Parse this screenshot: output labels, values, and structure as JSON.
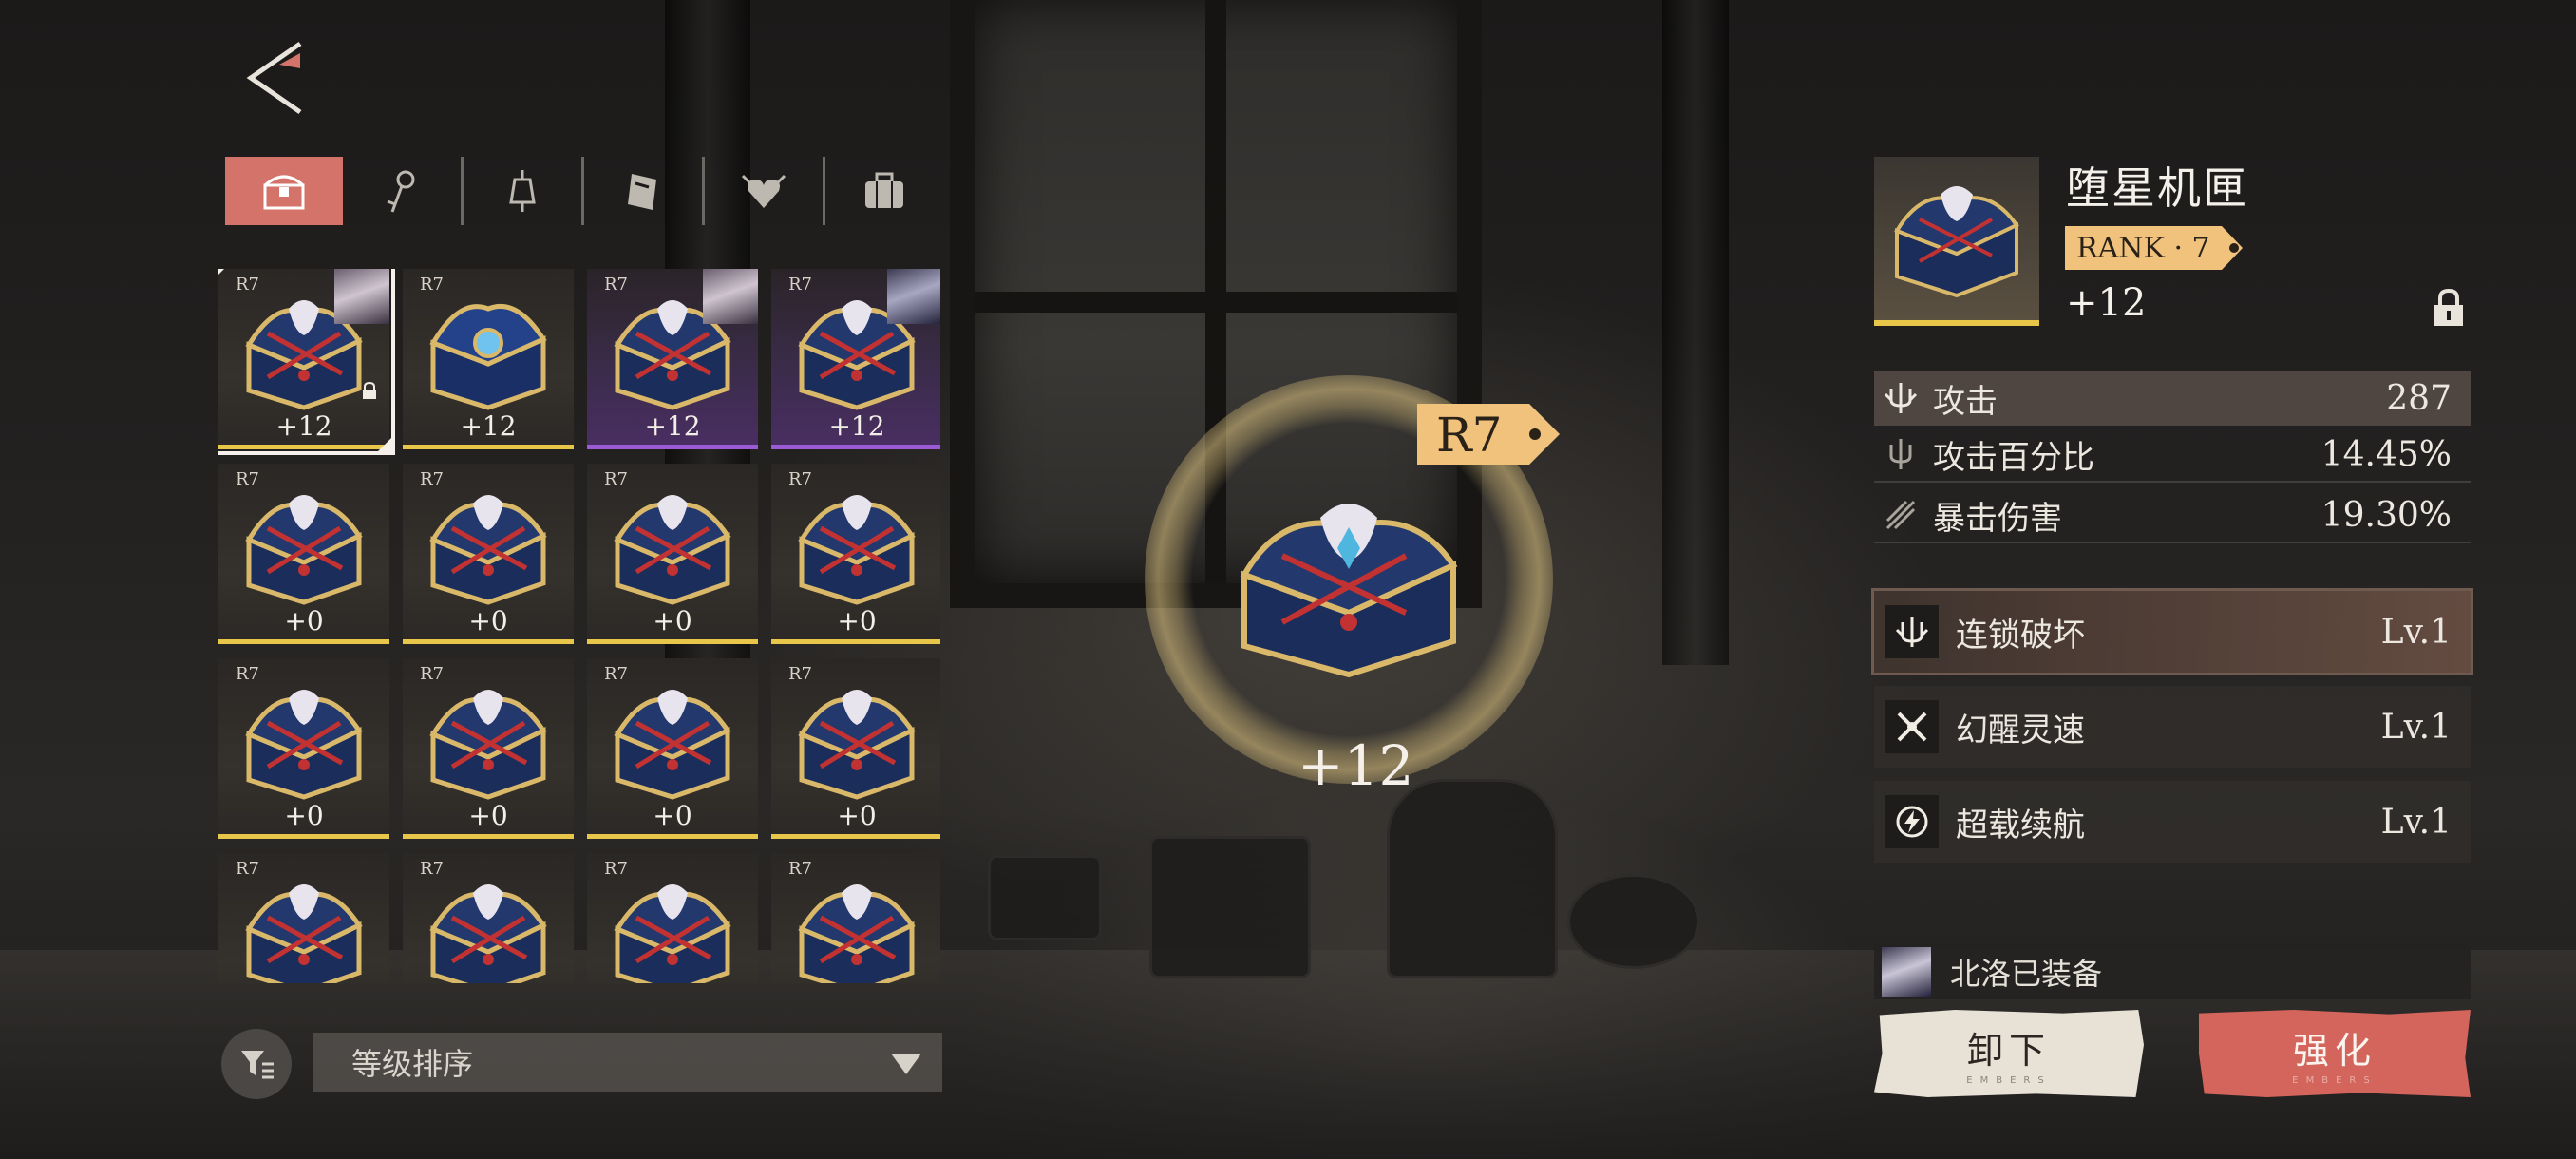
{
  "tabs": [
    {
      "name": "chest-tab",
      "icon": "chest-icon",
      "active": true
    },
    {
      "name": "key-tab",
      "icon": "key-icon",
      "active": false
    },
    {
      "name": "lantern-tab",
      "icon": "lantern-icon",
      "active": false
    },
    {
      "name": "book-tab",
      "icon": "book-icon",
      "active": false
    },
    {
      "name": "heart-tab",
      "icon": "winged-heart-icon",
      "active": false
    },
    {
      "name": "suitcase-tab",
      "icon": "suitcase-icon",
      "active": false
    }
  ],
  "grid": {
    "items": [
      {
        "rank": "R7",
        "level": "+12",
        "rarity": "gold",
        "equipped_avatar": true,
        "locked": true,
        "selected": true,
        "chest": "starfall"
      },
      {
        "rank": "R7",
        "level": "+12",
        "rarity": "gold",
        "equipped_avatar": false,
        "locked": false,
        "selected": false,
        "chest": "blue-gem"
      },
      {
        "rank": "R7",
        "level": "+12",
        "rarity": "purple",
        "equipped_avatar": true,
        "locked": false,
        "selected": false,
        "chest": "starfall"
      },
      {
        "rank": "R7",
        "level": "+12",
        "rarity": "purple",
        "equipped_avatar": true,
        "locked": false,
        "selected": false,
        "chest": "starfall"
      },
      {
        "rank": "R7",
        "level": "+0",
        "rarity": "gold",
        "chest": "starfall"
      },
      {
        "rank": "R7",
        "level": "+0",
        "rarity": "gold",
        "chest": "starfall"
      },
      {
        "rank": "R7",
        "level": "+0",
        "rarity": "gold",
        "chest": "starfall"
      },
      {
        "rank": "R7",
        "level": "+0",
        "rarity": "gold",
        "chest": "starfall"
      },
      {
        "rank": "R7",
        "level": "+0",
        "rarity": "gold",
        "chest": "starfall"
      },
      {
        "rank": "R7",
        "level": "+0",
        "rarity": "gold",
        "chest": "starfall"
      },
      {
        "rank": "R7",
        "level": "+0",
        "rarity": "gold",
        "chest": "starfall"
      },
      {
        "rank": "R7",
        "level": "+0",
        "rarity": "gold",
        "chest": "starfall"
      },
      {
        "rank": "R7",
        "level": "",
        "rarity": "gold",
        "chest": "starfall"
      },
      {
        "rank": "R7",
        "level": "",
        "rarity": "gold",
        "chest": "starfall"
      },
      {
        "rank": "R7",
        "level": "",
        "rarity": "gold",
        "chest": "starfall"
      },
      {
        "rank": "R7",
        "level": "",
        "rarity": "gold",
        "chest": "starfall"
      }
    ]
  },
  "sort": {
    "label": "等级排序"
  },
  "showcase": {
    "rank": "R7",
    "level": "+12"
  },
  "detail": {
    "name": "堕星机匣",
    "rank_label": "RANK · 7",
    "level": "+12",
    "main_stat": {
      "name": "攻击",
      "value": "287",
      "icon": "trident-icon"
    },
    "sub_stats": [
      {
        "name": "攻击百分比",
        "value": "14.45%",
        "icon": "trident-icon"
      },
      {
        "name": "暴击伤害",
        "value": "19.30%",
        "icon": "crit-icon"
      }
    ],
    "skills": [
      {
        "name": "连锁破坏",
        "level": "Lv.1",
        "icon": "chain-break-icon",
        "active": true
      },
      {
        "name": "幻醒灵速",
        "level": "Lv.1",
        "icon": "crossed-blades-icon",
        "active": false
      },
      {
        "name": "超载续航",
        "level": "Lv.1",
        "icon": "lightning-circle-icon",
        "active": false
      }
    ],
    "equipped_by": "北洛已装备"
  },
  "buttons": {
    "unequip": "卸下",
    "upgrade": "强化",
    "subtext": "EMBERS"
  },
  "colors": {
    "accent": "#d4736a",
    "gold": "#e8c64a",
    "purple": "#9b5ad6",
    "rank_tag": "#f0c27c"
  }
}
